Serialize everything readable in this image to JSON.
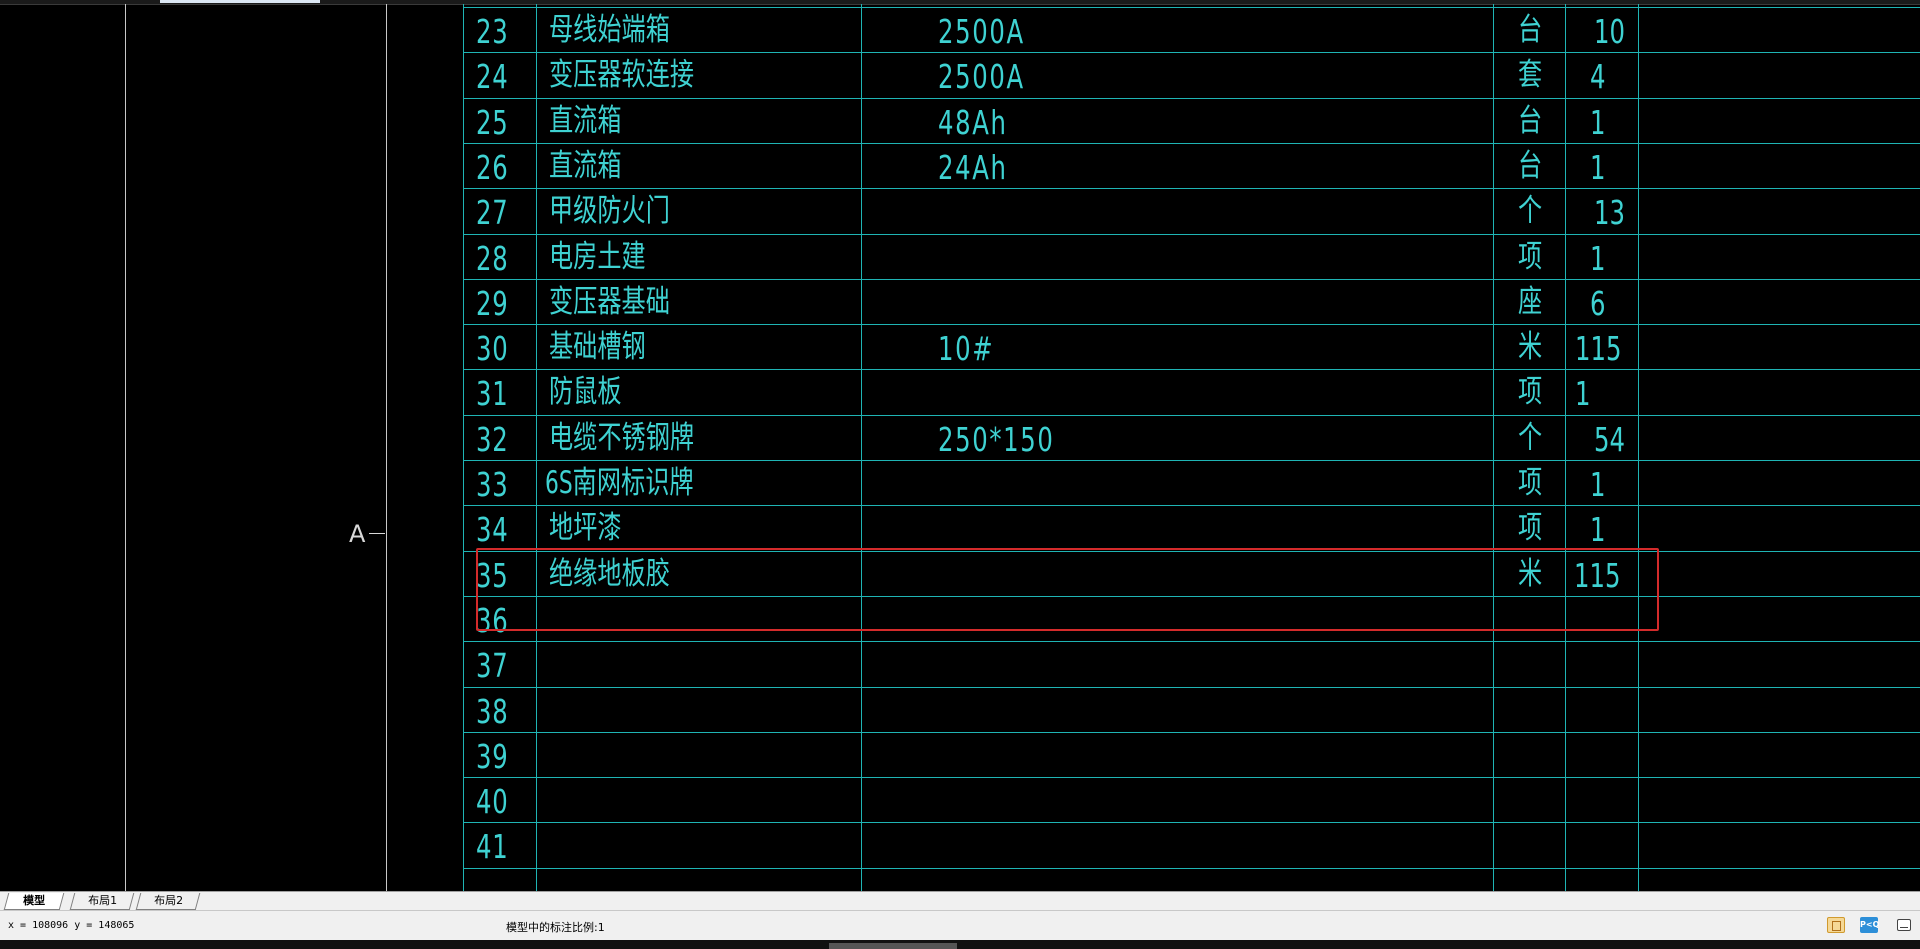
{
  "axis": {
    "label": "A"
  },
  "table": {
    "rows": [
      {
        "no": "23",
        "name": "母线始端箱",
        "spec": "2500A",
        "unit": "台",
        "qty": "10"
      },
      {
        "no": "24",
        "name": "变压器软连接",
        "spec": "2500A",
        "unit": "套",
        "qty": "4"
      },
      {
        "no": "25",
        "name": "直流箱",
        "spec": "48Ah",
        "unit": "台",
        "qty": "1"
      },
      {
        "no": "26",
        "name": "直流箱",
        "spec": "24Ah",
        "unit": "台",
        "qty": "1"
      },
      {
        "no": "27",
        "name": "甲级防火门",
        "spec": "",
        "unit": "个",
        "qty": "13"
      },
      {
        "no": "28",
        "name": "电房土建",
        "spec": "",
        "unit": "项",
        "qty": "1"
      },
      {
        "no": "29",
        "name": "变压器基础",
        "spec": "",
        "unit": "座",
        "qty": "6"
      },
      {
        "no": "30",
        "name": "基础槽钢",
        "spec": "10#",
        "unit": "米",
        "qty": "115"
      },
      {
        "no": "31",
        "name": "防鼠板",
        "spec": "",
        "unit": "项",
        "qty": "1"
      },
      {
        "no": "32",
        "name": "电缆不锈钢牌",
        "spec": "250*150",
        "unit": "个",
        "qty": "54"
      },
      {
        "no": "33",
        "name": "6S南网标识牌",
        "spec": "",
        "unit": "项",
        "qty": "1"
      },
      {
        "no": "34",
        "name": "地坪漆",
        "spec": "",
        "unit": "项",
        "qty": "1"
      },
      {
        "no": "35",
        "name": "绝缘地板胶",
        "spec": "",
        "unit": "米",
        "qty": "115"
      },
      {
        "no": "36",
        "name": "",
        "spec": "",
        "unit": "",
        "qty": ""
      },
      {
        "no": "37",
        "name": "",
        "spec": "",
        "unit": "",
        "qty": ""
      },
      {
        "no": "38",
        "name": "",
        "spec": "",
        "unit": "",
        "qty": ""
      },
      {
        "no": "39",
        "name": "",
        "spec": "",
        "unit": "",
        "qty": ""
      },
      {
        "no": "40",
        "name": "",
        "spec": "",
        "unit": "",
        "qty": ""
      },
      {
        "no": "41",
        "name": "",
        "spec": "",
        "unit": "",
        "qty": ""
      }
    ]
  },
  "tabs": [
    {
      "label": "模型",
      "active": true
    },
    {
      "label": "布局1",
      "active": false
    },
    {
      "label": "布局2",
      "active": false
    }
  ],
  "status": {
    "coords": "x = 108096  y = 148065",
    "scale_text": "模型中的标注比例:1",
    "pq_icon_label": "P<Q"
  },
  "colors": {
    "background": "#000000",
    "cad_text": "#3fd2d2",
    "grid_line": "#1fb4b4",
    "highlight": "#d42b2b"
  }
}
